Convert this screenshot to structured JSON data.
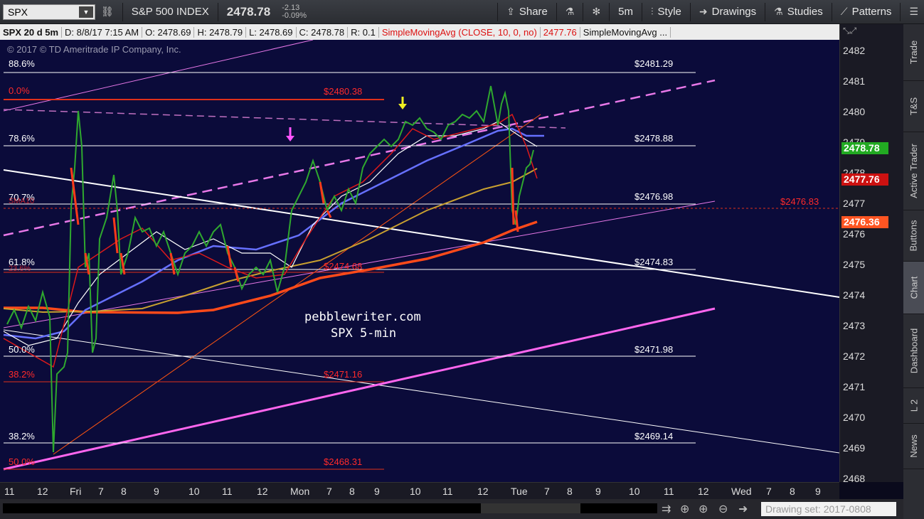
{
  "toolbar": {
    "symbol": "SPX",
    "description": "S&P 500 INDEX",
    "price": "2478.78",
    "change": "-2.13",
    "change_pct": "-0.09%",
    "share": "Share",
    "interval": "5m",
    "style": "Style",
    "drawings": "Drawings",
    "studies": "Studies",
    "patterns": "Patterns"
  },
  "studybar": {
    "title": "SPX 20 d 5m",
    "date": "D: 8/8/17 7:15 AM",
    "open": "O: 2478.69",
    "high": "H: 2478.79",
    "low": "L: 2478.69",
    "close": "C: 2478.78",
    "range": "R: 0.1",
    "sma1": "SimpleMovingAvg (CLOSE, 10, 0, no)",
    "sma1_value": "2477.76",
    "sma2": "SimpleMovingAvg ..."
  },
  "chart": {
    "copyright": "© 2017 © TD Ameritrade IP Company, Inc.",
    "watermark_line1": "pebblewriter.com",
    "watermark_line2": "SPX 5-min",
    "fib_labels": [
      {
        "pct": "88.6%",
        "value": "$2481.29",
        "color": "white"
      },
      {
        "pct": "0.0%",
        "value": "$2480.38",
        "color": "red"
      },
      {
        "pct": "78.6%",
        "value": "$2478.88",
        "color": "white"
      },
      {
        "pct": "70.7%",
        "value": "$2476.98",
        "color": "white"
      },
      {
        "pct": "SMA10",
        "value": "$2476.83",
        "color": "red"
      },
      {
        "pct": "61.8%",
        "value": "$2474.83",
        "color": "white"
      },
      {
        "pct": "23.6%",
        "value": "$2474.68",
        "color": "red"
      },
      {
        "pct": "50.0%",
        "value": "$2471.98",
        "color": "white"
      },
      {
        "pct": "38.2%",
        "value": "$2471.16",
        "color": "red"
      },
      {
        "pct": "38.2%",
        "value": "$2469.14",
        "color": "white"
      },
      {
        "pct": "50.0%",
        "value": "$2468.31",
        "color": "red"
      }
    ]
  },
  "price_axis": {
    "ticks": [
      "2482",
      "2481",
      "2480",
      "2479",
      "2478",
      "2477",
      "2476",
      "2475",
      "2474",
      "2473",
      "2472",
      "2471",
      "2470",
      "2469",
      "2468"
    ],
    "tag_last": "2478.78",
    "tag_sma10": "2477.76",
    "tag_sma": "2476.36",
    "colors": {
      "last": "#22aa22",
      "sma10": "#cc1111",
      "sma": "#ff5522"
    }
  },
  "time_axis": {
    "labels": [
      "11",
      "12",
      "Fri",
      "7",
      "8",
      "9",
      "10",
      "11",
      "12",
      "Mon",
      "7",
      "8",
      "9",
      "10",
      "11",
      "12",
      "Tue",
      "7",
      "8",
      "9",
      "10",
      "11",
      "12",
      "Wed",
      "7",
      "8",
      "9"
    ]
  },
  "sidetabs": [
    "Trade",
    "T&S",
    "Active Trader",
    "Buttons",
    "Chart",
    "Dashboard",
    "L 2",
    "News"
  ],
  "bottombar": {
    "drawing_set": "Drawing set: 2017-0808"
  }
}
